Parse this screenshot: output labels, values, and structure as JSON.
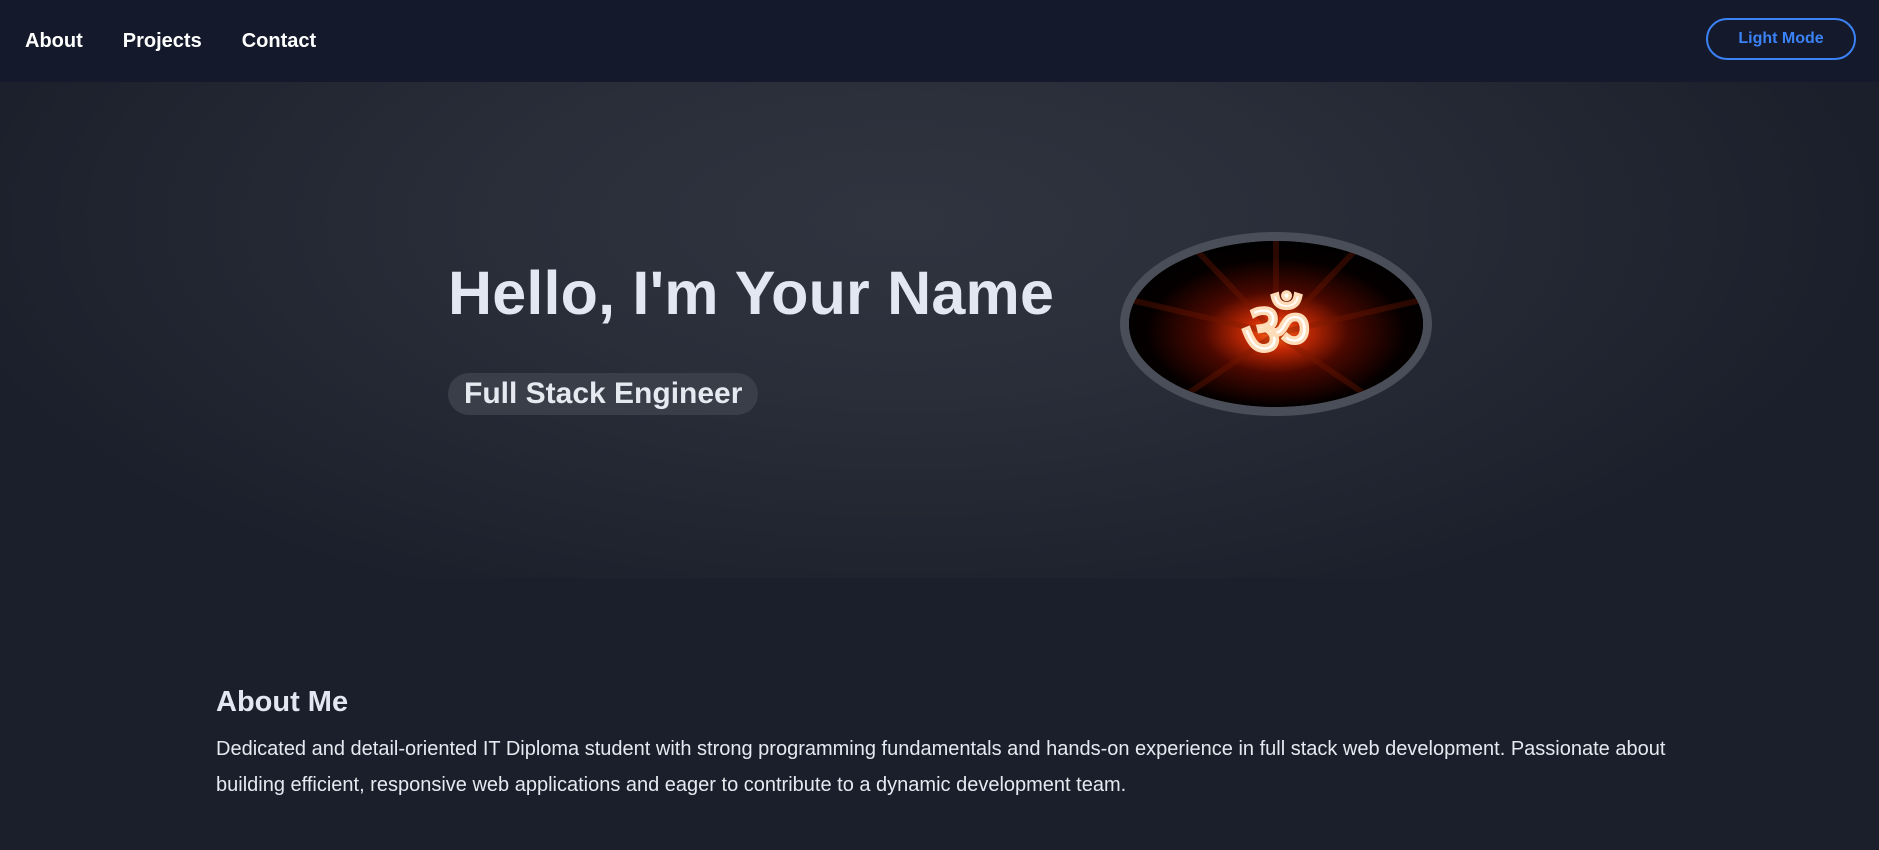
{
  "nav": {
    "links": [
      {
        "label": "About"
      },
      {
        "label": "Projects"
      },
      {
        "label": "Contact"
      }
    ],
    "theme_toggle_label": "Light Mode"
  },
  "hero": {
    "greeting": "Hello, I'm Your Name",
    "role": "Full Stack Engineer",
    "avatar_icon": "om-symbol-icon"
  },
  "about": {
    "title": "About Me",
    "text": "Dedicated and detail-oriented IT Diploma student with strong programming fundamentals and hands-on experience in full stack web development. Passionate about building efficient, responsive web applications and eager to contribute to a dynamic development team."
  },
  "colors": {
    "nav_bg": "#141a2b",
    "page_bg": "#1b1f2b",
    "accent": "#3b82f6",
    "badge_bg": "#3a3e49",
    "avatar_ring": "#4a4e58"
  }
}
